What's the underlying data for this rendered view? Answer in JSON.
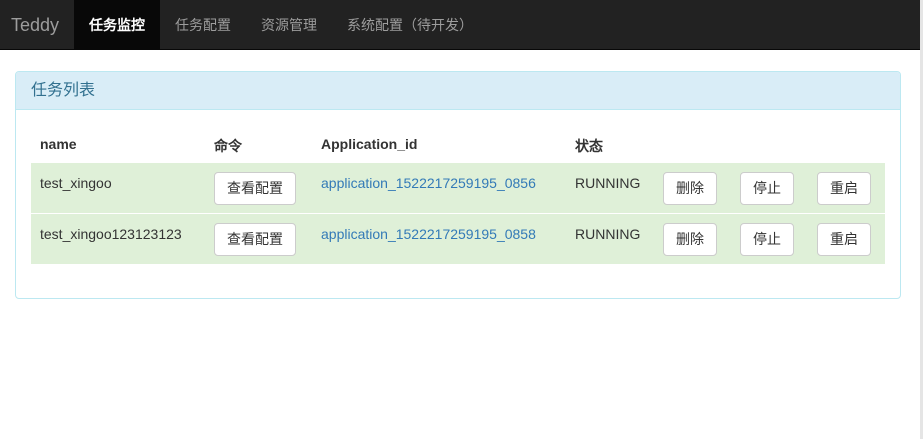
{
  "navbar": {
    "brand": "Teddy",
    "items": [
      {
        "label": "任务监控",
        "active": true
      },
      {
        "label": "任务配置"
      },
      {
        "label": "资源管理"
      },
      {
        "label": "系统配置（待开发）"
      }
    ]
  },
  "panel": {
    "title": "任务列表",
    "columns": [
      "name",
      "命令",
      "Application_id",
      "状态"
    ],
    "rows": [
      {
        "name": "test_xingoo",
        "command_button": "查看配置",
        "application_id": "application_1522217259195_0856",
        "status": "RUNNING",
        "delete": "删除",
        "stop": "停止",
        "restart": "重启"
      },
      {
        "name": "test_xingoo123123123",
        "command_button": "查看配置",
        "application_id": "application_1522217259195_0858",
        "status": "RUNNING",
        "delete": "删除",
        "stop": "停止",
        "restart": "重启"
      }
    ]
  },
  "colors": {
    "navbar_bg": "#222222",
    "active_nav_bg": "#080808",
    "panel_heading_bg": "#d9edf7",
    "panel_heading_text": "#31708f",
    "row_success_bg": "#dff0d8",
    "link": "#337ab7"
  }
}
